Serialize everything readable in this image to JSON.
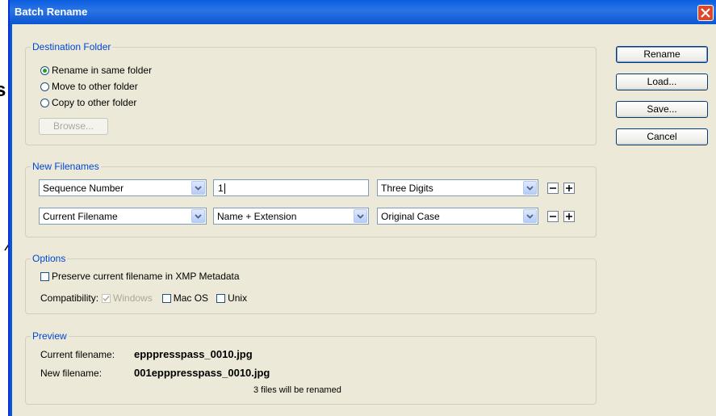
{
  "window": {
    "title": "Batch Rename"
  },
  "destination": {
    "legend": "Destination Folder",
    "options": [
      "Rename in same folder",
      "Move to other folder",
      "Copy to other folder"
    ],
    "selected_index": 0,
    "browse_label": "Browse..."
  },
  "filenames": {
    "legend": "New Filenames",
    "row1": {
      "select1": "Sequence Number",
      "text_value": "1",
      "select3": "Three Digits"
    },
    "row2": {
      "select1": "Current Filename",
      "select2": "Name + Extension",
      "select3": "Original Case"
    }
  },
  "options": {
    "legend": "Options",
    "preserve_label": "Preserve current filename in XMP Metadata",
    "preserve_checked": false,
    "compat_label": "Compatibility:",
    "compat_windows": "Windows",
    "compat_windows_checked": true,
    "compat_macos": "Mac OS",
    "compat_unix": "Unix"
  },
  "preview": {
    "legend": "Preview",
    "current_label": "Current filename:",
    "current_value": "epppresspass_0010.jpg",
    "new_label": "New filename:",
    "new_value": "001epppresspass_0010.jpg",
    "count_text": "3 files will be renamed"
  },
  "buttons": {
    "rename": "Rename",
    "load": "Load...",
    "save": "Save...",
    "cancel": "Cancel"
  },
  "colors": {
    "title_bar": "#0a5ddf",
    "legend_text": "#0046d5",
    "dialog_bg": "#ece9d8",
    "close_button": "#e0472a"
  }
}
